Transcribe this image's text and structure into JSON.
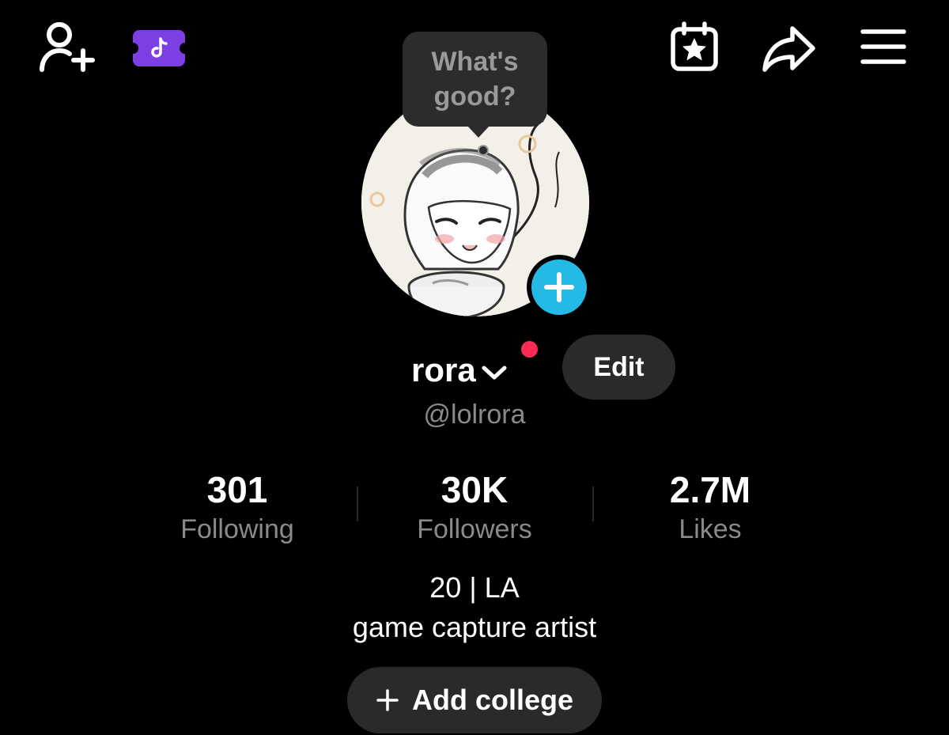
{
  "topbar": {
    "icons": [
      "add-friend-icon",
      "tiktok-ticket-icon",
      "calendar-star-icon",
      "share-icon",
      "menu-icon"
    ]
  },
  "tooltip": {
    "line1": "What's",
    "line2": "good?"
  },
  "profile": {
    "display_name": "rora",
    "handle": "@lolrora",
    "edit_label": "Edit"
  },
  "stats": {
    "following": {
      "value": "301",
      "label": "Following"
    },
    "followers": {
      "value": "30K",
      "label": "Followers"
    },
    "likes": {
      "value": "2.7M",
      "label": "Likes"
    }
  },
  "bio": {
    "line1": "20 | LA",
    "line2": "game capture artist"
  },
  "add_college": {
    "label": "Add college"
  },
  "colors": {
    "background": "#000000",
    "accent_blue": "#25b9e6",
    "notification_red": "#fe2c55",
    "pill_bg": "#2a2a2a",
    "secondary_text": "#8a8a8a",
    "ticket_purple": "#7b3fe4"
  }
}
